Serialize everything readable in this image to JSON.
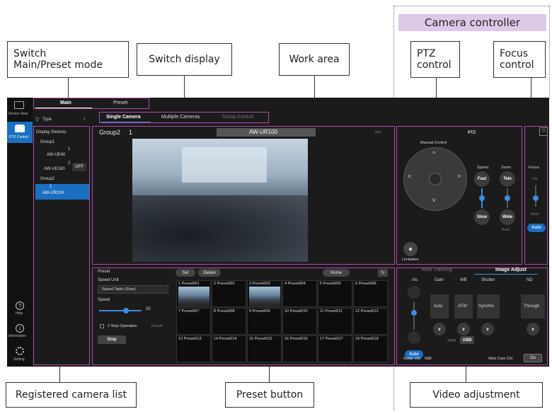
{
  "callouts": {
    "switch_mode": "Switch\nMain/Preset mode",
    "switch_display": "Switch display",
    "work_area": "Work area",
    "camera_controller": "Camera controller",
    "ptz_control": "PTZ\ncontrol",
    "focus_control": "Focus\ncontrol",
    "registered_list": "Registered camera list",
    "preset_button": "Preset button",
    "video_adjustment": "Video adjustment"
  },
  "sidebar": {
    "device_view": "Device View",
    "ptz_control": "PTZ Control",
    "help": "Help",
    "information": "Information",
    "setting": "Setting"
  },
  "mode_tabs": {
    "main": "Main",
    "preset": "Preset"
  },
  "display_tabs": {
    "single": "Single Camera",
    "multiple": "Multiple Cameras",
    "group": "Group Control"
  },
  "device_list": {
    "filter": "Type",
    "title": "Display Devices",
    "group1": "Group1",
    "group2": "Group2",
    "cam1_num": "1",
    "cam1_name": "AW-UE40",
    "cam2_num": "2",
    "cam2_name": "AW-UE160",
    "cam2_badge": "OFF",
    "cam3_num": "1",
    "cam3_name": "AW-UR100"
  },
  "work": {
    "group": "Group2",
    "number": "1",
    "camera": "AW-UR100",
    "rec": "Rec"
  },
  "ptz": {
    "title": "PTZ",
    "manual": "Manual Control",
    "speed": "Speed",
    "zoom": "Zoom",
    "fast": "Fast",
    "slow": "Slow",
    "tele": "Tele",
    "wide": "Wide",
    "auto": "Auto",
    "limitation": "Limitation"
  },
  "focus": {
    "title": "Focus",
    "far": "Far",
    "near": "Near",
    "auto": "Auto"
  },
  "preset": {
    "title": "Preset",
    "speed_unit": "Speed Unit",
    "speed_table": "Speed Table (Slow)",
    "speed": "Speed",
    "speed_value": "20",
    "two_step": "2 Step Operation",
    "recall": "Recall",
    "stop": "Stop",
    "set": "Set",
    "delete": "Delete",
    "home": "Home",
    "slots": [
      {
        "n": "1",
        "name": "Preset001"
      },
      {
        "n": "2",
        "name": "Preset002"
      },
      {
        "n": "3",
        "name": "Preset003"
      },
      {
        "n": "4",
        "name": "Preset004"
      },
      {
        "n": "5",
        "name": "Preset005"
      },
      {
        "n": "6",
        "name": "Preset006"
      },
      {
        "n": "7",
        "name": "Preset007"
      },
      {
        "n": "8",
        "name": "Preset008"
      },
      {
        "n": "9",
        "name": "Preset009"
      },
      {
        "n": "10",
        "name": "Preset010"
      },
      {
        "n": "11",
        "name": "Preset011"
      },
      {
        "n": "12",
        "name": "Preset012"
      },
      {
        "n": "13",
        "name": "Preset013"
      },
      {
        "n": "14",
        "name": "Preset014"
      },
      {
        "n": "15",
        "name": "Preset015"
      },
      {
        "n": "16",
        "name": "Preset016"
      },
      {
        "n": "17",
        "name": "Preset017"
      },
      {
        "n": "18",
        "name": "Preset018"
      }
    ]
  },
  "image_adjust": {
    "tab_tracking": "Auto Tracking",
    "tab_adjust": "Image Adjust",
    "iris": "Iris",
    "gain": "Gain",
    "wb": "WB",
    "shutter": "Shutter",
    "nd": "ND",
    "gain_val": "Auto",
    "wb_val": "ATW",
    "shutter_val": "Synchro",
    "nd_val": "Through",
    "iris_auto": "Auto",
    "awb": "AWB",
    "abb": "ABB",
    "audio": "Audio Vol.",
    "audio_val": "0dB",
    "webcam": "Web Cam Ctrl",
    "go": "Go"
  }
}
